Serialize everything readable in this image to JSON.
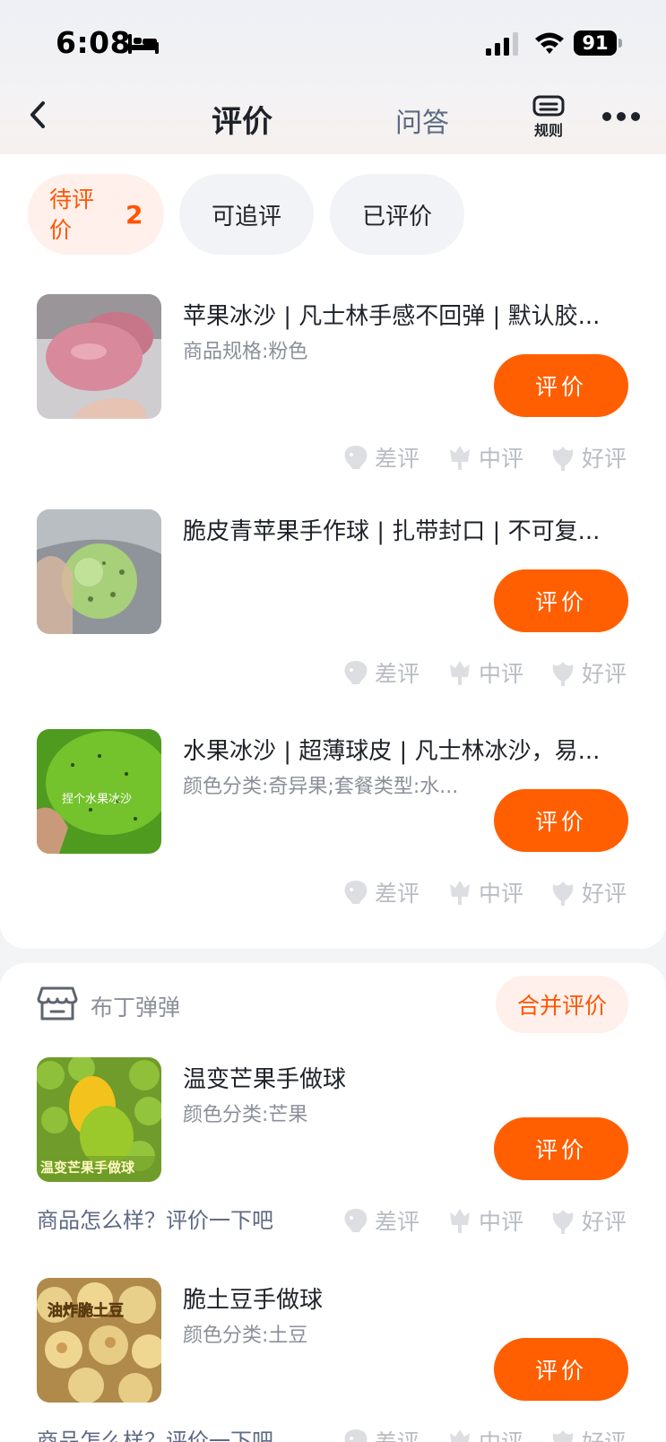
{
  "status_bar": {
    "time": "6:08",
    "battery": "91"
  },
  "nav": {
    "title": "评价",
    "qa_tab": "问答",
    "rules_label": "规则"
  },
  "filters": {
    "pending_label": "待评价",
    "pending_count": "2",
    "followup_label": "可追评",
    "done_label": "已评价"
  },
  "rating": {
    "bad": "差评",
    "mid": "中评",
    "good": "好评"
  },
  "review_button": "评价",
  "prompt": "商品怎么样？评价一下吧",
  "items": [
    {
      "title": "苹果冰沙 | 凡士林手感不回弹 | 默认胶...",
      "spec": "商品规格:粉色"
    },
    {
      "title": "脆皮青苹果手作球 | 扎带封口 | 不可复...",
      "spec": ""
    },
    {
      "title": "水果冰沙 | 超薄球皮 | 凡士林冰沙，易...",
      "spec": "颜色分类:奇异果;套餐类型:水...",
      "image_text": "捏个水果冰沙"
    }
  ],
  "shop": {
    "name": "布丁弹弹",
    "merge_label": "合并评价",
    "items": [
      {
        "title": "温变芒果手做球",
        "spec": "颜色分类:芒果",
        "image_text": "温变芒果手做球"
      },
      {
        "title": "脆土豆手做球",
        "spec": "颜色分类:土豆",
        "image_text": "油炸脆土豆"
      }
    ]
  },
  "colors": {
    "accent": "#ff5f00",
    "accent_soft": "#fff0eb",
    "muted": "#b9bcc3"
  }
}
